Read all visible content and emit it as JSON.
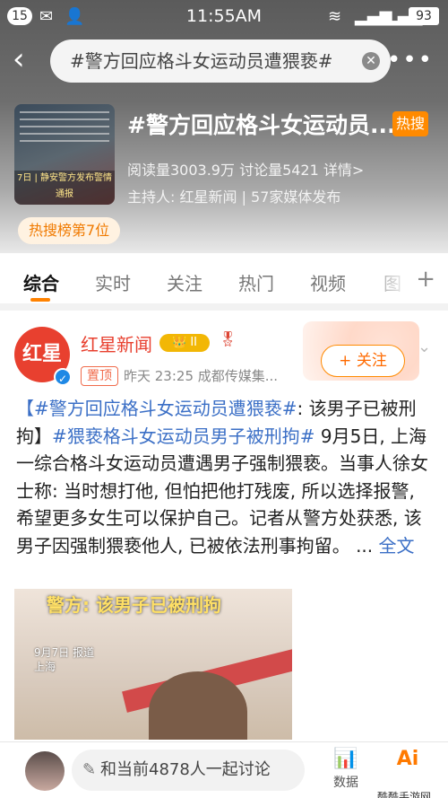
{
  "status_bar": {
    "notif_count": "15",
    "time": "11:55AM",
    "battery": "93"
  },
  "search": {
    "query": "#警方回应格斗女运动员遭猥亵#"
  },
  "topic": {
    "title": "#警方回应格斗女运动员...",
    "hot_badge": "热搜",
    "stats": "阅读量3003.9万  讨论量5421  详情>",
    "host": "主持人: 红星新闻 | 57家媒体发布",
    "rank_chip": "热搜榜第7位",
    "thumb_caption": "7日 | 静安警方发布警情通报"
  },
  "tabs": {
    "items": [
      {
        "label": "综合"
      },
      {
        "label": "实时"
      },
      {
        "label": "关注"
      },
      {
        "label": "热门"
      },
      {
        "label": "视频"
      },
      {
        "label": "图"
      }
    ],
    "plus": "+"
  },
  "post": {
    "avatar_text": "红星",
    "author": "红星新闻",
    "vip_level": "II",
    "pin_label": "置顶",
    "meta": "昨天 23:25  成都传媒集...",
    "follow": "+ 关注",
    "hashtag1": "【#警方回应格斗女运动员遭猥亵#",
    "text1": ": 该男子已被刑拘】",
    "hashtag2": "#猥亵格斗女运动员男子被刑拘#",
    "body": " 9月5日, 上海一综合格斗女运动员遭遇男子强制猥亵。当事人徐女士称: 当时想打他, 但怕把他打残废, 所以选择报警, 希望更多女生可以保护自己。记者从警方处获悉, 该男子因强制猥亵他人, 已被依法刑事拘留。 ...",
    "more": "全文",
    "image_caption": "警方: 该男子已被刑拘",
    "image_date": "9月7日 报道",
    "image_place": "上海"
  },
  "bottom": {
    "comment_prompt": "和当前4878人一起讨论",
    "data_label": "数据",
    "ai_label": "Ai",
    "watermark": "酷酷手游网"
  }
}
